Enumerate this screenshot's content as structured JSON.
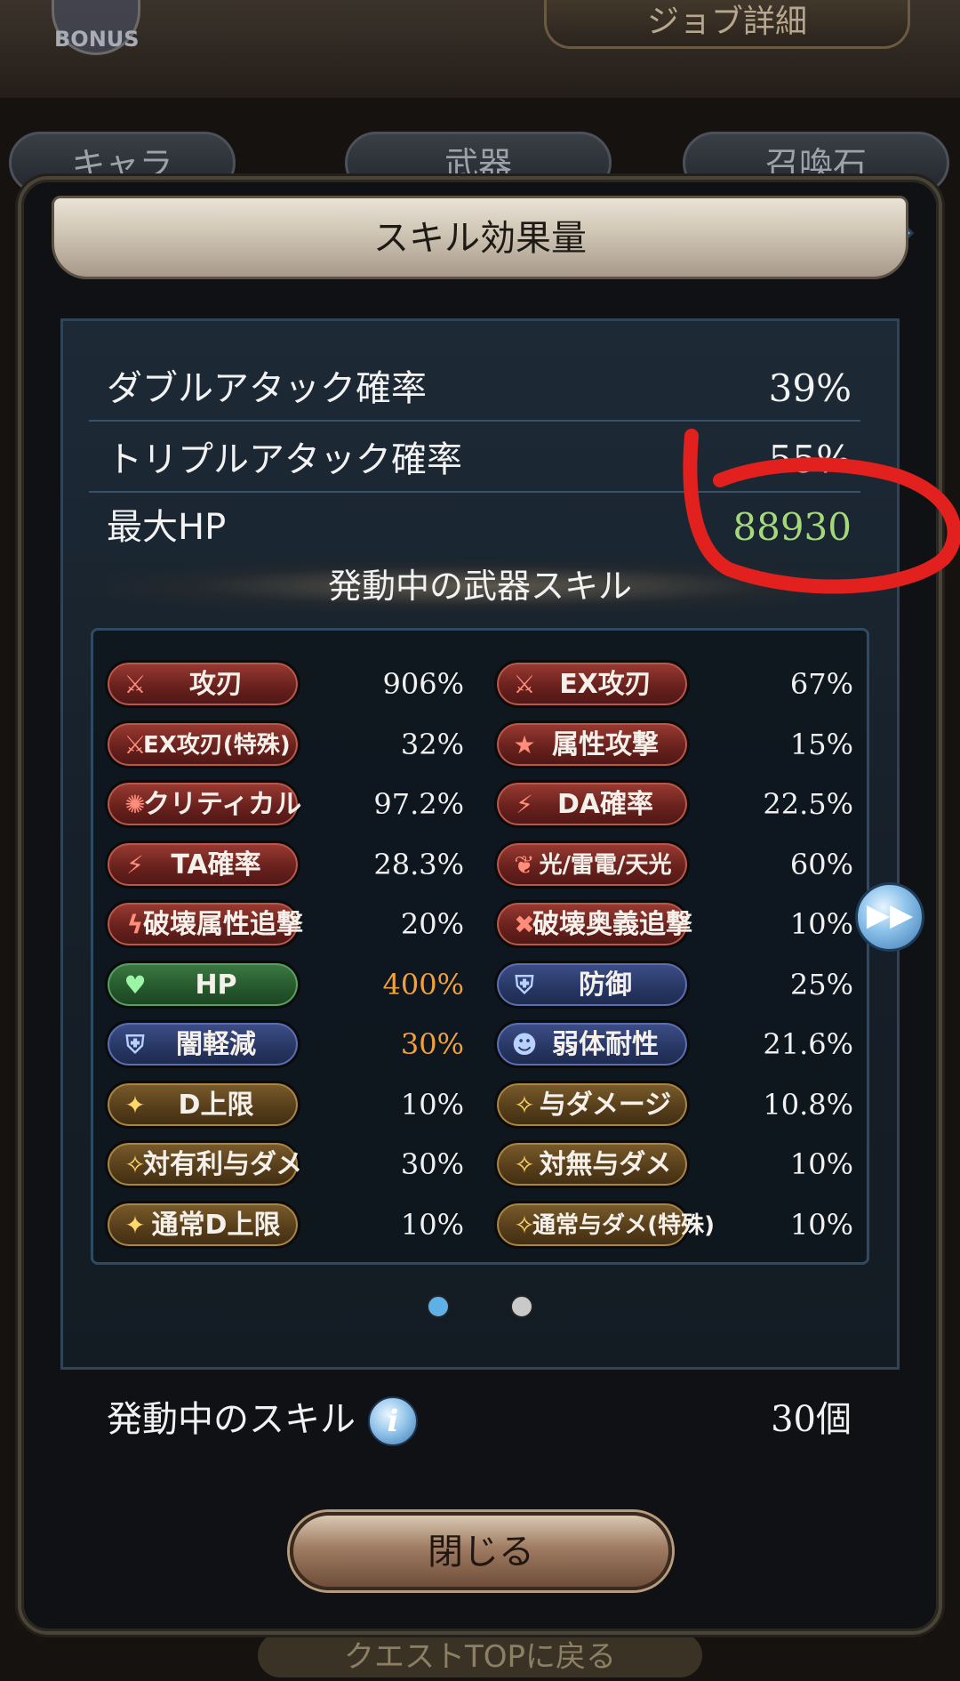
{
  "background": {
    "bonus_label": "BONUS",
    "job_detail_label": "ジョブ詳細",
    "tabs": [
      {
        "label": "キャラ"
      },
      {
        "label": "武器"
      },
      {
        "label": "召喚石"
      }
    ],
    "quest_top_label": "クエストTOPに戻る"
  },
  "modal": {
    "title": "スキル効果量",
    "stats": [
      {
        "label": "ダブルアタック確率",
        "value": "39%"
      },
      {
        "label": "トリプルアタック確率",
        "value": "55%"
      },
      {
        "label": "最大HP",
        "value": "88930",
        "color": "#a4d87a"
      }
    ],
    "section_title": "発動中の武器スキル",
    "skills_left": [
      {
        "label": "攻刃",
        "value": "906%",
        "style": "red",
        "icon": "sword-icon"
      },
      {
        "label": "EX攻刃(特殊)",
        "value": "32%",
        "style": "red",
        "icon": "sword-icon"
      },
      {
        "label": "クリティカル",
        "value": "97.2%",
        "style": "red",
        "icon": "burst-icon"
      },
      {
        "label": "TA確率",
        "value": "28.3%",
        "style": "red",
        "icon": "triple-slash-icon"
      },
      {
        "label": "破壊属性追撃",
        "value": "20%",
        "style": "red",
        "icon": "lightning-icon"
      },
      {
        "label": "HP",
        "value": "400%",
        "style": "green",
        "icon": "heart-icon",
        "value_color": "orange"
      },
      {
        "label": "闇軽減",
        "value": "30%",
        "style": "blue",
        "icon": "shield-icon",
        "value_color": "orange"
      },
      {
        "label": "D上限",
        "value": "10%",
        "style": "gold",
        "icon": "damage-cap-icon"
      },
      {
        "label": "対有利与ダメ",
        "value": "30%",
        "style": "gold",
        "icon": "slash-icon"
      },
      {
        "label": "通常D上限",
        "value": "10%",
        "style": "gold",
        "icon": "damage-cap-icon"
      }
    ],
    "skills_right": [
      {
        "label": "EX攻刃",
        "value": "67%",
        "style": "red",
        "icon": "sword-icon"
      },
      {
        "label": "属性攻撃",
        "value": "15%",
        "style": "red",
        "icon": "star-icon"
      },
      {
        "label": "DA確率",
        "value": "22.5%",
        "style": "red",
        "icon": "double-slash-icon"
      },
      {
        "label": "光/雷電/天光",
        "value": "60%",
        "style": "red",
        "icon": "feather-icon"
      },
      {
        "label": "破壊奥義追撃",
        "value": "10%",
        "style": "red",
        "icon": "cross-icon"
      },
      {
        "label": "防御",
        "value": "25%",
        "style": "blue",
        "icon": "shield-icon"
      },
      {
        "label": "弱体耐性",
        "value": "21.6%",
        "style": "blue",
        "icon": "person-icon"
      },
      {
        "label": "与ダメージ",
        "value": "10.8%",
        "style": "gold",
        "icon": "slash-icon"
      },
      {
        "label": "対無与ダメ",
        "value": "10%",
        "style": "gold",
        "icon": "slash-icon"
      },
      {
        "label": "通常与ダメ(特殊)",
        "value": "10%",
        "style": "gold",
        "icon": "slash-icon"
      }
    ],
    "active_skills_label": "発動中のスキル",
    "active_skills_count": "30個",
    "close_label": "閉じる",
    "page_indicator": {
      "current": 1,
      "total": 2
    }
  },
  "colors": {
    "hp_value": "#a4d87a",
    "orange_value": "#f0a03d",
    "annotation_red": "#e2211e"
  }
}
